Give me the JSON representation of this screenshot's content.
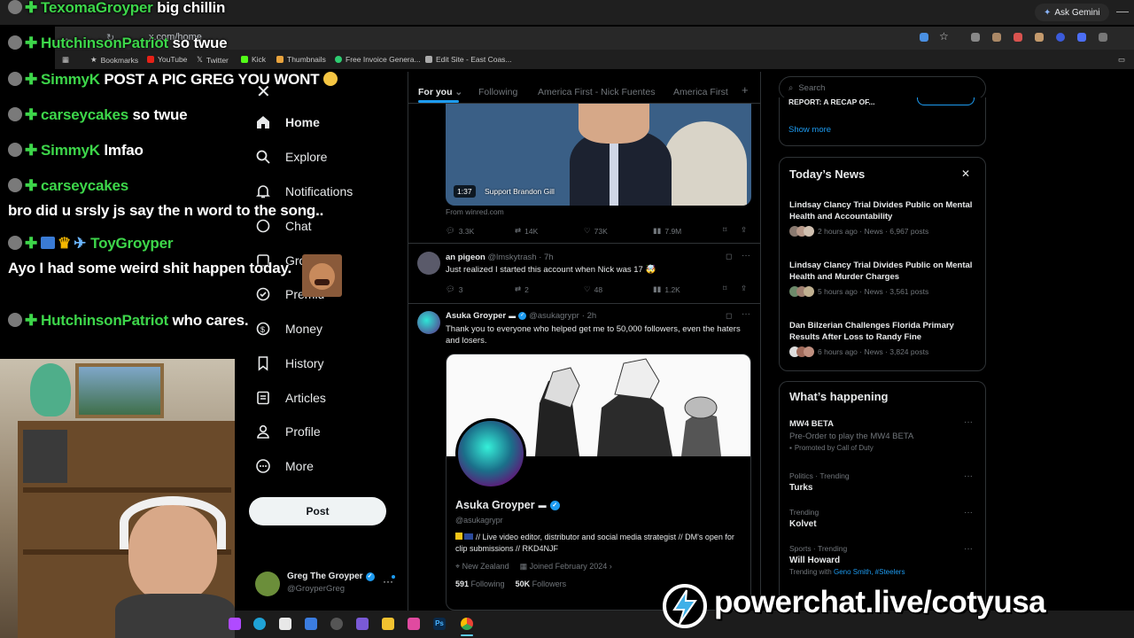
{
  "browser": {
    "url": "x.com/home",
    "ask_gemini": "Ask Gemini",
    "bookmarks": [
      "Bookmarks",
      "YouTube",
      "Twitter",
      "Kick",
      "Thumbnails",
      "Free Invoice Genera...",
      "Edit Site - East Coas..."
    ]
  },
  "chat_overlay": [
    {
      "name": "TexomaGroyper",
      "msg": "big chillin"
    },
    {
      "name": "HutchinsonPatriot",
      "msg": "so twue"
    },
    {
      "name": "SimmyK",
      "msg": "POST A PIC GREG YOU WONT"
    },
    {
      "name": "carseycakes",
      "msg": "so twue"
    },
    {
      "name": "SimmyK",
      "msg": "lmfao"
    },
    {
      "name": "carseycakes",
      "msg": "bro did u srsly js say the n word to the song.."
    },
    {
      "name": "ToyGroyper",
      "msg": "Ayo I had some weird shit happen today."
    },
    {
      "name": "HutchinsonPatriot",
      "msg": "who cares."
    }
  ],
  "sidebar": {
    "items": [
      {
        "label": "Home",
        "icon": "home-icon"
      },
      {
        "label": "Explore",
        "icon": "search-icon"
      },
      {
        "label": "Notifications",
        "icon": "bell-icon"
      },
      {
        "label": "Chat",
        "icon": "chat-icon"
      },
      {
        "label": "Grok",
        "icon": "grok-icon"
      },
      {
        "label": "Premium",
        "icon": "premium-icon"
      },
      {
        "label": "Money",
        "icon": "money-icon"
      },
      {
        "label": "History",
        "icon": "bookmark-icon"
      },
      {
        "label": "Articles",
        "icon": "articles-icon"
      },
      {
        "label": "Profile",
        "icon": "person-icon"
      },
      {
        "label": "More",
        "icon": "more-icon"
      }
    ],
    "grok_label_visible": "Gro",
    "premium_label_visible": "Premiu",
    "post_button": "Post",
    "account": {
      "name": "Greg The Groyper",
      "handle": "@GroyperGreg"
    }
  },
  "feed": {
    "tabs": [
      "For you",
      "Following",
      "America First - Nick Fuentes",
      "America First"
    ],
    "video": {
      "duration": "1:37",
      "caption": "Support Brandon Gill",
      "source": "From winred.com"
    },
    "video_stats": {
      "replies": "3.3K",
      "reposts": "14K",
      "likes": "73K",
      "views": "7.9M"
    },
    "post1": {
      "author": "an pigeon",
      "handle": "@lmskytrash",
      "time": "· 7h",
      "text": "Just realized I started this account when Nick was 17 🤯",
      "replies": "3",
      "reposts": "2",
      "likes": "48",
      "views": "1.2K"
    },
    "post2": {
      "author": "Asuka Groyper",
      "handle": "@asukagrypr",
      "time": "· 2h",
      "text": "Thank you to everyone who helped get me to 50,000 followers, even the haters and losers."
    },
    "profile_card": {
      "name": "Asuka Groyper",
      "handle": "@asukagrypr",
      "bio": "// Live video editor, distributor and social media strategist // DM's open for clip submissions // RKD4NJF",
      "location": "New Zealand",
      "joined": "Joined February 2024",
      "following_count": "591",
      "following_label": "Following",
      "followers_count": "50K",
      "followers_label": "Followers"
    }
  },
  "right": {
    "search_placeholder": "Search",
    "cut_text": "REPORT: A RECAP OF...",
    "show_more": "Show more",
    "todays_news": {
      "title": "Today’s News",
      "items": [
        {
          "title": "Lindsay Clancy Trial Divides Public on Mental Health and Accountability",
          "meta": "2 hours ago · News · 6,967 posts"
        },
        {
          "title": "Lindsay Clancy Trial Divides Public on Mental Health and Murder Charges",
          "meta": "5 hours ago · News · 3,561 posts"
        },
        {
          "title": "Dan Bilzerian Challenges Florida Primary Results After Loss to Randy Fine",
          "meta": "6 hours ago · News · 3,824 posts"
        }
      ]
    },
    "whats_happening": {
      "title": "What’s happening",
      "ad": {
        "name": "MW4 BETA",
        "desc": "Pre-Order to play the MW4 BETA",
        "promoted": "Promoted by Call of Duty"
      },
      "trends": [
        {
          "meta": "Politics · Trending",
          "name": "Turks"
        },
        {
          "meta": "Trending",
          "name": "Kolvet"
        },
        {
          "meta": "Sports · Trending",
          "name": "Will Howard",
          "extra_prefix": "Trending with",
          "extra": "Geno Smith, #Steelers"
        }
      ]
    }
  },
  "powerchat": {
    "text": "powerchat.live/cotyusa",
    "accent": "#3fb0e8"
  },
  "colors": {
    "accent": "#1d9bf0",
    "chat_name": "#3dd64a",
    "verified": "#1d9bf0"
  }
}
